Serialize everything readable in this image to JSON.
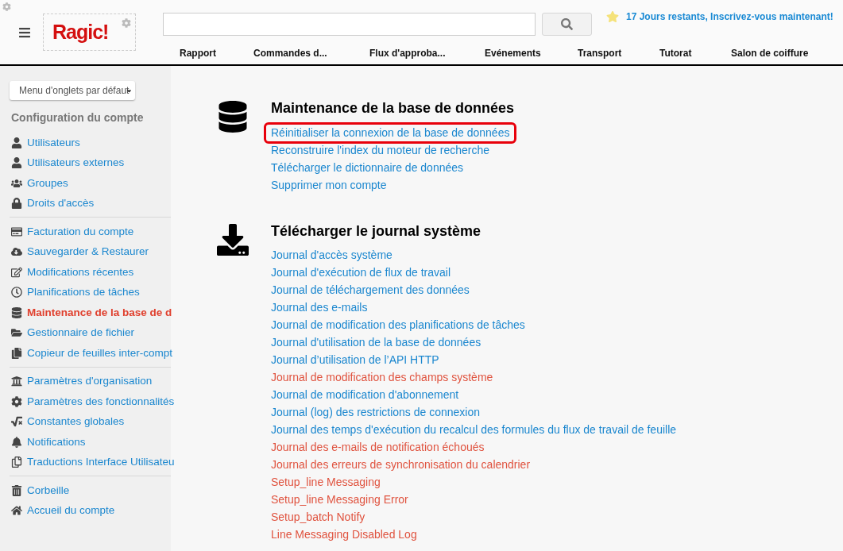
{
  "header": {
    "logo": "Ragic!",
    "trial_notice": "17 Jours restants, Inscrivez-vous maintenant!",
    "tabs": [
      {
        "label": "Rapport",
        "selected": false
      },
      {
        "label": "Commandes d...",
        "selected": false
      },
      {
        "label": "Flux d'approba...",
        "selected": false
      },
      {
        "label": "Evénements",
        "selected": false
      },
      {
        "label": "Transport",
        "selected": false
      },
      {
        "label": "Tutorat",
        "selected": false
      },
      {
        "label": "Salon de coiffure",
        "selected": false
      }
    ]
  },
  "sidebar": {
    "tab_menu": "Menu d'onglets par défaut",
    "title": "Configuration du compte",
    "groups": [
      [
        {
          "label": "Utilisateurs",
          "selected": false
        },
        {
          "label": "Utilisateurs externes",
          "selected": false
        },
        {
          "label": "Groupes",
          "selected": false
        },
        {
          "label": "Droits d'accès",
          "selected": false
        }
      ],
      [
        {
          "label": "Facturation du compte",
          "selected": false
        },
        {
          "label": "Sauvegarder & Restaurer",
          "selected": false
        },
        {
          "label": "Modifications récentes",
          "selected": false
        },
        {
          "label": "Planifications de tâches",
          "selected": false
        },
        {
          "label": "Maintenance de la base de d",
          "selected": true
        },
        {
          "label": "Gestionnaire de fichier",
          "selected": false
        },
        {
          "label": "Copieur de feuilles inter-compt",
          "selected": false
        }
      ],
      [
        {
          "label": "Paramètres d'organisation",
          "selected": false
        },
        {
          "label": "Paramètres des fonctionnalités",
          "selected": false
        },
        {
          "label": "Constantes globales",
          "selected": false
        },
        {
          "label": "Notifications",
          "selected": false
        },
        {
          "label": "Traductions Interface Utilisateu",
          "selected": false
        }
      ],
      [
        {
          "label": "Corbeille",
          "selected": false
        },
        {
          "label": "Accueil du compte",
          "selected": false
        }
      ]
    ]
  },
  "sections": [
    {
      "title": "Maintenance de la base de données",
      "links": [
        {
          "label": "Réinitialiser la connexion de la base de données",
          "color": "#1b87cf",
          "highlighted": true
        },
        {
          "label": "Reconstruire l'index du moteur de recherche",
          "color": "#1b87cf",
          "highlighted": false
        },
        {
          "label": "Télécharger le dictionnaire de données",
          "color": "#1b87cf",
          "highlighted": false
        },
        {
          "label": "Supprimer mon compte",
          "color": "#1b87cf",
          "highlighted": false
        }
      ]
    },
    {
      "title": "Télécharger le journal système",
      "links": [
        {
          "label": "Journal d'accès système",
          "color": "#1b87cf",
          "highlighted": false
        },
        {
          "label": "Journal d'exécution de flux de travail",
          "color": "#1b87cf",
          "highlighted": false
        },
        {
          "label": "Journal de téléchargement des données",
          "color": "#1b87cf",
          "highlighted": false
        },
        {
          "label": "Journal des e-mails",
          "color": "#1b87cf",
          "highlighted": false
        },
        {
          "label": "Journal de modification des planifications de tâches",
          "color": "#1b87cf",
          "highlighted": false
        },
        {
          "label": "Journal d'utilisation de la base de données",
          "color": "#1b87cf",
          "highlighted": false
        },
        {
          "label": "Journal d’utilisation de l’API HTTP",
          "color": "#1b87cf",
          "highlighted": false
        },
        {
          "label": "Journal de modification des champs système",
          "color": "#e0533f",
          "highlighted": false
        },
        {
          "label": "Journal de modification d'abonnement",
          "color": "#1b87cf",
          "highlighted": false
        },
        {
          "label": "Journal (log) des restrictions de connexion",
          "color": "#1b87cf",
          "highlighted": false
        },
        {
          "label": "Journal des temps d'exécution du recalcul des formules du flux de travail de feuille",
          "color": "#1b87cf",
          "highlighted": false
        },
        {
          "label": "Journal des e-mails de notification échoués",
          "color": "#e0533f",
          "highlighted": false
        },
        {
          "label": "Journal des erreurs de synchronisation du calendrier",
          "color": "#e0533f",
          "highlighted": false
        },
        {
          "label": "Setup_line Messaging",
          "color": "#e0533f",
          "highlighted": false
        },
        {
          "label": "Setup_line Messaging Error",
          "color": "#e0533f",
          "highlighted": false
        },
        {
          "label": "Setup_batch Notify",
          "color": "#e0533f",
          "highlighted": false
        },
        {
          "label": "Line Messaging Disabled Log",
          "color": "#e0533f",
          "highlighted": false
        }
      ]
    }
  ]
}
